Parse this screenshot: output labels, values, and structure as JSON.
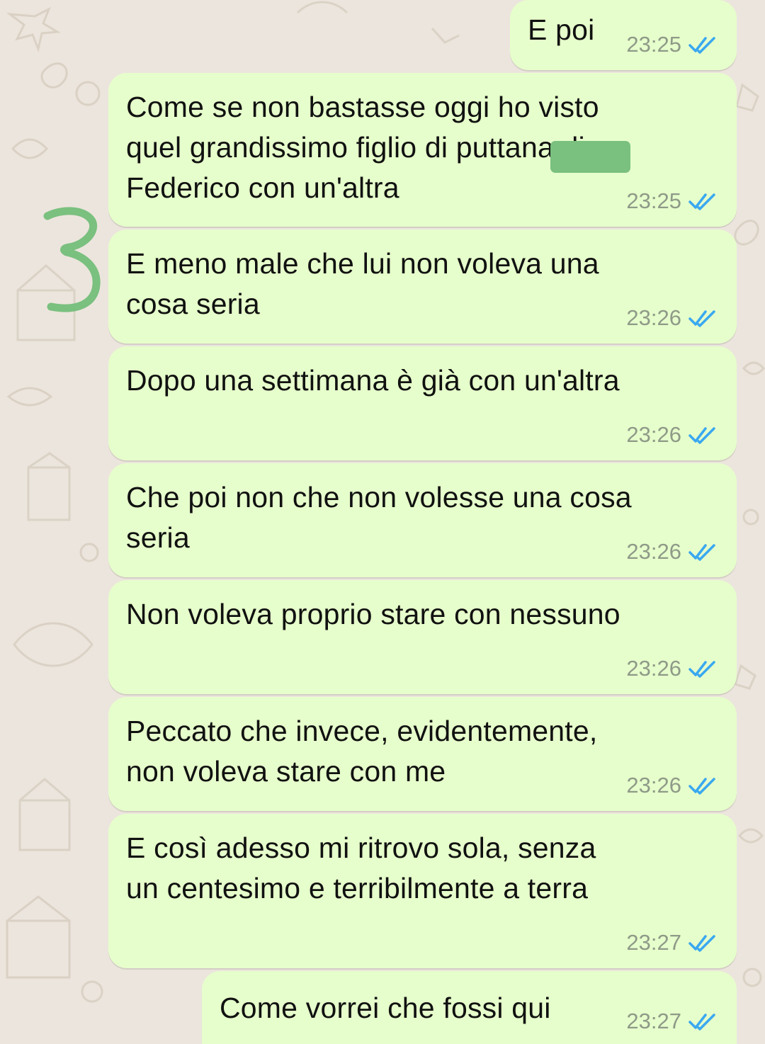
{
  "colors": {
    "bubble": "#e6fecb",
    "background": "#ece5dd",
    "read_tick": "#3aa8f0",
    "annotation_marker": "#7ac07f",
    "time": "#8e9a88"
  },
  "messages": [
    {
      "text": "E poi",
      "time": "23:25",
      "status": "read"
    },
    {
      "text": "Come se non bastasse oggi ho visto\nquel grandissimo figlio di puttana di\nFederico con un'altra",
      "time": "23:25",
      "status": "read"
    },
    {
      "text": "E meno male che lui non voleva una\ncosa seria",
      "time": "23:26",
      "status": "read"
    },
    {
      "text": "Dopo una settimana è già con un'altra",
      "time": "23:26",
      "status": "read"
    },
    {
      "text": "Che poi non che non volesse una cosa\nseria",
      "time": "23:26",
      "status": "read"
    },
    {
      "text": "Non voleva proprio stare con nessuno",
      "time": "23:26",
      "status": "read"
    },
    {
      "text": "Peccato che invece, evidentemente,\nnon voleva stare con me",
      "time": "23:26",
      "status": "read"
    },
    {
      "text": "E così adesso mi ritrovo sola, senza\nun centesimo e terribilmente a terra",
      "time": "23:27",
      "status": "read"
    },
    {
      "text": "Come vorrei che fossi qui",
      "time": "23:27",
      "status": "read"
    }
  ],
  "annotation": {
    "label": "3",
    "icon": "handwritten-number-marker"
  },
  "icons": {
    "status": "double-check-icon",
    "wallpaper": "doodle-pattern"
  }
}
